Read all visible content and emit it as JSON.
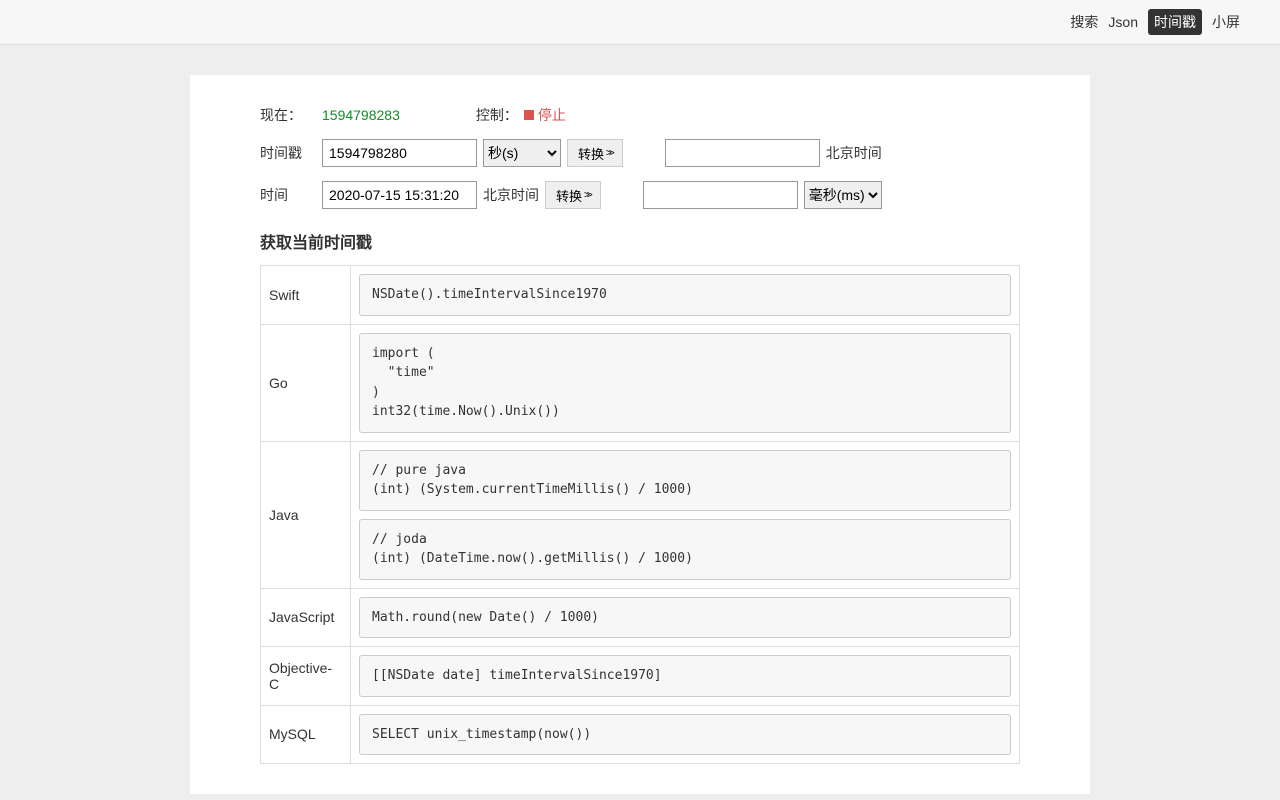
{
  "nav": {
    "search": "搜索",
    "json": "Json",
    "ts": "时间戳",
    "small": "小屏"
  },
  "now": {
    "label": "现在：",
    "value": "1594798283",
    "ctrl_label": "控制：",
    "stop": "停止"
  },
  "ts": {
    "label": "时间戳",
    "value": "1594798280",
    "unit_opts": [
      "秒(s)",
      "毫秒(ms)"
    ],
    "unit": "秒(s)",
    "convert": "转换",
    "result_label": "北京时间"
  },
  "time": {
    "label": "时间",
    "value": "2020-07-15 15:31:20",
    "tz": "北京时间",
    "convert": "转换",
    "unit_opts": [
      "秒(s)",
      "毫秒(ms)"
    ],
    "unit": "毫秒(ms)"
  },
  "heading": "获取当前时间戳",
  "snippets": [
    {
      "lang": "Swift",
      "code": [
        "NSDate().timeIntervalSince1970"
      ]
    },
    {
      "lang": "Go",
      "code": [
        "import (\n  \"time\"\n)\nint32(time.Now().Unix())"
      ]
    },
    {
      "lang": "Java",
      "code": [
        "// pure java\n(int) (System.currentTimeMillis() / 1000)",
        "// joda\n(int) (DateTime.now().getMillis() / 1000)"
      ]
    },
    {
      "lang": "JavaScript",
      "code": [
        "Math.round(new Date() / 1000)"
      ]
    },
    {
      "lang": "Objective-C",
      "code": [
        "[[NSDate date] timeIntervalSince1970]"
      ]
    },
    {
      "lang": "MySQL",
      "code": [
        "SELECT unix_timestamp(now())"
      ]
    }
  ]
}
